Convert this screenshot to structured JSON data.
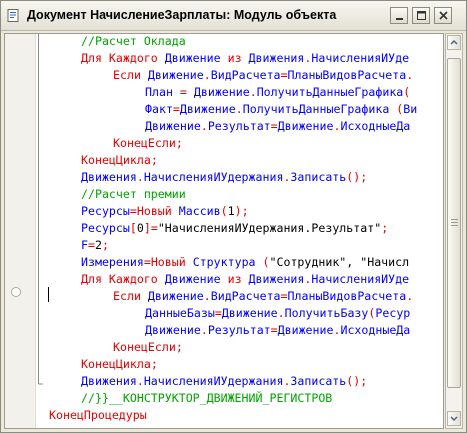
{
  "window": {
    "title": "Документ НачислениеЗарплаты: Модуль объекта"
  },
  "colors": {
    "keyword": "#e60000",
    "identifier": "#0000ff",
    "comment": "#00a400",
    "string": "#000000"
  },
  "icons": {
    "app": "module-document-icon",
    "minimize": "minimize-icon",
    "maximize": "maximize-icon",
    "close": "close-icon",
    "breakpoint": "breakpoint-marker-icon"
  },
  "code": {
    "lines": [
      {
        "segments": [
          {
            "t": "//Расчет Оклада",
            "c": "cm"
          }
        ]
      },
      {
        "segments": [
          {
            "t": "Для Каждого ",
            "c": "kw"
          },
          {
            "t": "Движение ",
            "c": "id"
          },
          {
            "t": "из ",
            "c": "kw"
          },
          {
            "t": "Движения",
            "c": "id"
          },
          {
            "t": ".",
            "c": "op"
          },
          {
            "t": "НачисленияИУде",
            "c": "id"
          }
        ]
      },
      {
        "segments": [
          {
            "t": "Если ",
            "c": "kw"
          },
          {
            "t": "Движение",
            "c": "id"
          },
          {
            "t": ".",
            "c": "op"
          },
          {
            "t": "ВидРасчета",
            "c": "id"
          },
          {
            "t": "=",
            "c": "op"
          },
          {
            "t": "ПланыВидовРасчета",
            "c": "id"
          },
          {
            "t": ".",
            "c": "op"
          }
        ]
      },
      {
        "segments": [
          {
            "t": "План ",
            "c": "id"
          },
          {
            "t": "= ",
            "c": "op"
          },
          {
            "t": "Движение",
            "c": "id"
          },
          {
            "t": ".",
            "c": "op"
          },
          {
            "t": "ПолучитьДанныеГрафика",
            "c": "id"
          },
          {
            "t": "(",
            "c": "op"
          }
        ]
      },
      {
        "segments": [
          {
            "t": "Факт",
            "c": "id"
          },
          {
            "t": "=",
            "c": "op"
          },
          {
            "t": "Движение",
            "c": "id"
          },
          {
            "t": ".",
            "c": "op"
          },
          {
            "t": "ПолучитьДанныеГрафика ",
            "c": "id"
          },
          {
            "t": "(",
            "c": "op"
          },
          {
            "t": "Ви",
            "c": "id"
          }
        ]
      },
      {
        "segments": [
          {
            "t": "Движение",
            "c": "id"
          },
          {
            "t": ".",
            "c": "op"
          },
          {
            "t": "Результат",
            "c": "id"
          },
          {
            "t": "=",
            "c": "op"
          },
          {
            "t": "Движение",
            "c": "id"
          },
          {
            "t": ".",
            "c": "op"
          },
          {
            "t": "ИсходныеДа",
            "c": "id"
          }
        ]
      },
      {
        "segments": [
          {
            "t": "КонецЕсли",
            "c": "kw"
          },
          {
            "t": ";",
            "c": "op"
          }
        ]
      },
      {
        "segments": [
          {
            "t": "КонецЦикла",
            "c": "kw"
          },
          {
            "t": ";",
            "c": "op"
          }
        ]
      },
      {
        "segments": [
          {
            "t": "Движения",
            "c": "id"
          },
          {
            "t": ".",
            "c": "op"
          },
          {
            "t": "НачисленияИУдержания",
            "c": "id"
          },
          {
            "t": ".",
            "c": "op"
          },
          {
            "t": "Записать",
            "c": "id"
          },
          {
            "t": "();",
            "c": "op"
          }
        ]
      },
      {
        "segments": [
          {
            "t": "//Расчет премии",
            "c": "cm"
          }
        ]
      },
      {
        "segments": [
          {
            "t": "Ресурсы",
            "c": "id"
          },
          {
            "t": "=",
            "c": "op"
          },
          {
            "t": "Новый ",
            "c": "kw"
          },
          {
            "t": "Массив",
            "c": "id"
          },
          {
            "t": "(",
            "c": "op"
          },
          {
            "t": "1",
            "c": "st"
          },
          {
            "t": ");",
            "c": "op"
          }
        ]
      },
      {
        "segments": [
          {
            "t": "Ресурсы",
            "c": "id"
          },
          {
            "t": "[",
            "c": "op"
          },
          {
            "t": "0",
            "c": "st"
          },
          {
            "t": "]=",
            "c": "op"
          },
          {
            "t": "\"НачисленияИУдержания.Результат\"",
            "c": "st"
          },
          {
            "t": ";",
            "c": "op"
          }
        ]
      },
      {
        "segments": [
          {
            "t": "F",
            "c": "id"
          },
          {
            "t": "=",
            "c": "op"
          },
          {
            "t": "2",
            "c": "st"
          },
          {
            "t": ";",
            "c": "op"
          }
        ]
      },
      {
        "segments": [
          {
            "t": "Измерения",
            "c": "id"
          },
          {
            "t": "=",
            "c": "op"
          },
          {
            "t": "Новый ",
            "c": "kw"
          },
          {
            "t": "Структура ",
            "c": "id"
          },
          {
            "t": "(",
            "c": "op"
          },
          {
            "t": "\"Сотрудник\", \"Начисл",
            "c": "st"
          }
        ]
      },
      {
        "segments": [
          {
            "t": "Для Каждого ",
            "c": "kw"
          },
          {
            "t": "Движение ",
            "c": "id"
          },
          {
            "t": "из ",
            "c": "kw"
          },
          {
            "t": "Движения",
            "c": "id"
          },
          {
            "t": ".",
            "c": "op"
          },
          {
            "t": "НачисленияИУде",
            "c": "id"
          }
        ]
      },
      {
        "segments": [
          {
            "t": "Если ",
            "c": "kw"
          },
          {
            "t": "Движение",
            "c": "id"
          },
          {
            "t": ".",
            "c": "op"
          },
          {
            "t": "ВидРасчета",
            "c": "id"
          },
          {
            "t": "=",
            "c": "op"
          },
          {
            "t": "ПланыВидовРасчета",
            "c": "id"
          },
          {
            "t": ".",
            "c": "op"
          }
        ]
      },
      {
        "segments": [
          {
            "t": "ДанныеБазы",
            "c": "id"
          },
          {
            "t": "=",
            "c": "op"
          },
          {
            "t": "Движение",
            "c": "id"
          },
          {
            "t": ".",
            "c": "op"
          },
          {
            "t": "ПолучитьБазу",
            "c": "id"
          },
          {
            "t": "(",
            "c": "op"
          },
          {
            "t": "Ресур",
            "c": "id"
          }
        ]
      },
      {
        "segments": [
          {
            "t": "Движение",
            "c": "id"
          },
          {
            "t": ".",
            "c": "op"
          },
          {
            "t": "Результат",
            "c": "id"
          },
          {
            "t": "=",
            "c": "op"
          },
          {
            "t": "Движение",
            "c": "id"
          },
          {
            "t": ".",
            "c": "op"
          },
          {
            "t": "ИсходныеДа",
            "c": "id"
          }
        ]
      },
      {
        "segments": [
          {
            "t": "КонецЕсли",
            "c": "kw"
          },
          {
            "t": ";",
            "c": "op"
          }
        ]
      },
      {
        "segments": [
          {
            "t": "КонецЦикла",
            "c": "kw"
          },
          {
            "t": ";",
            "c": "op"
          }
        ]
      },
      {
        "segments": [
          {
            "t": "Движения",
            "c": "id"
          },
          {
            "t": ".",
            "c": "op"
          },
          {
            "t": "НачисленияИУдержания",
            "c": "id"
          },
          {
            "t": ".",
            "c": "op"
          },
          {
            "t": "Записать",
            "c": "id"
          },
          {
            "t": "();",
            "c": "op"
          }
        ]
      },
      {
        "segments": [
          {
            "t": "//}}__КОНСТРУКТОР_ДВИЖЕНИЙ_РЕГИСТРОВ",
            "c": "cm"
          }
        ]
      },
      {
        "segments": [
          {
            "t": "КонецПроцедуры",
            "c": "kw"
          }
        ]
      }
    ]
  }
}
